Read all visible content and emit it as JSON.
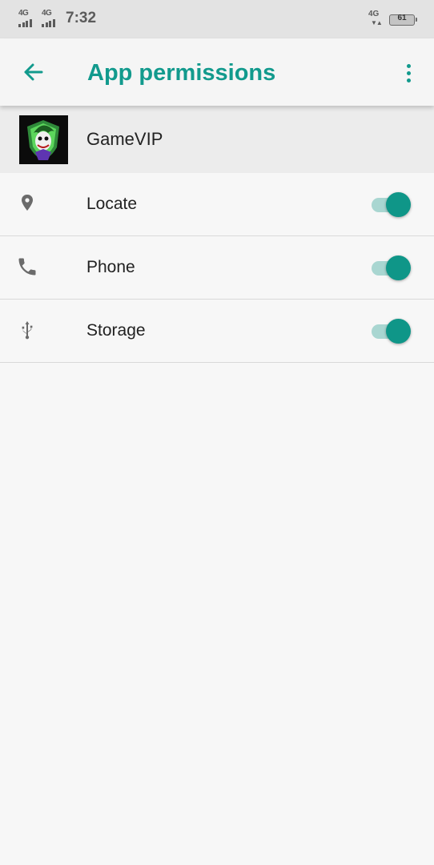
{
  "status_bar": {
    "sim1_network": "4G",
    "sim2_network": "4G",
    "time": "7:32",
    "data_network": "4G",
    "battery_level": "61"
  },
  "app_bar": {
    "title": "App permissions"
  },
  "app": {
    "name": "GameVIP"
  },
  "permissions": [
    {
      "label": "Locate",
      "icon": "location-pin-icon",
      "enabled": true
    },
    {
      "label": "Phone",
      "icon": "phone-icon",
      "enabled": true
    },
    {
      "label": "Storage",
      "icon": "usb-icon",
      "enabled": true
    }
  ],
  "colors": {
    "accent": "#129a8d",
    "toggle_thumb": "#0f9688",
    "toggle_track": "#a9d6d1",
    "status_bar_bg": "#e3e3e3"
  }
}
